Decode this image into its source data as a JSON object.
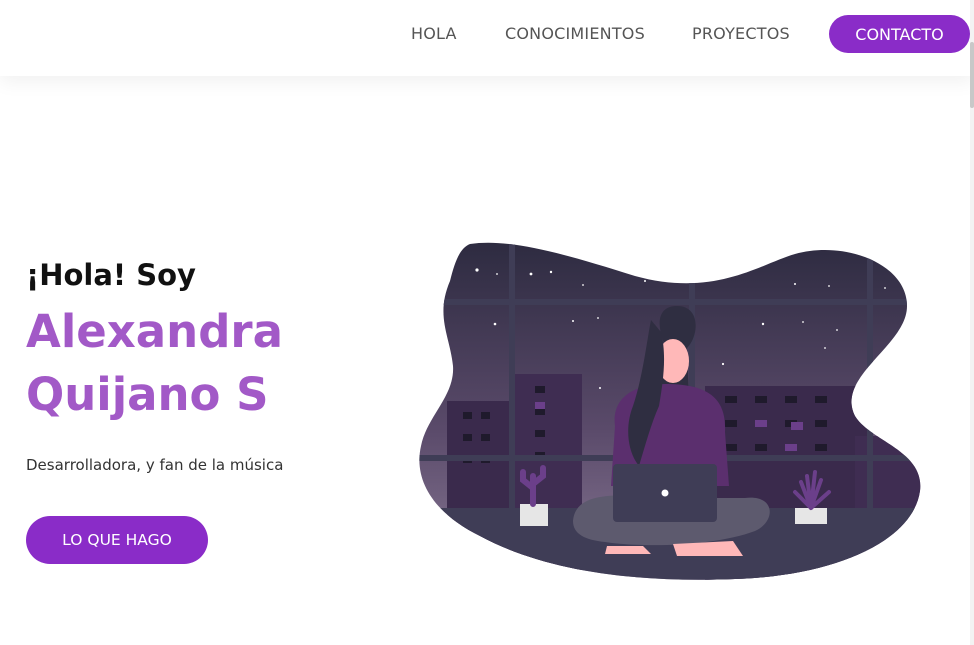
{
  "nav": {
    "links": [
      "HOLA",
      "CONOCIMIENTOS",
      "PROYECTOS"
    ],
    "contact_label": "CONTACTO"
  },
  "hero": {
    "greeting": "¡Hola! Soy",
    "name_line1": "Alexandra",
    "name_line2": "Quijano S",
    "tagline": "Desarrolladora, y fan de la música",
    "cta_label": "LO QUE HAGO"
  },
  "illustration": {
    "subject": "woman-with-laptop-icon",
    "colors": {
      "sky_top": "#2c2a3f",
      "sky_bottom": "#7a6a86",
      "buildings": "#3a2a4c",
      "window": "#5e3b7e",
      "frame": "#3f3d56",
      "floor": "#3f3d56",
      "sweater": "#5b2f6e",
      "hair": "#2f2e41",
      "skin": "#ffb8b8",
      "pants": "#5d5a6e"
    }
  },
  "theme": {
    "accent": "#8a2cc8",
    "name_color": "#a259c7"
  }
}
